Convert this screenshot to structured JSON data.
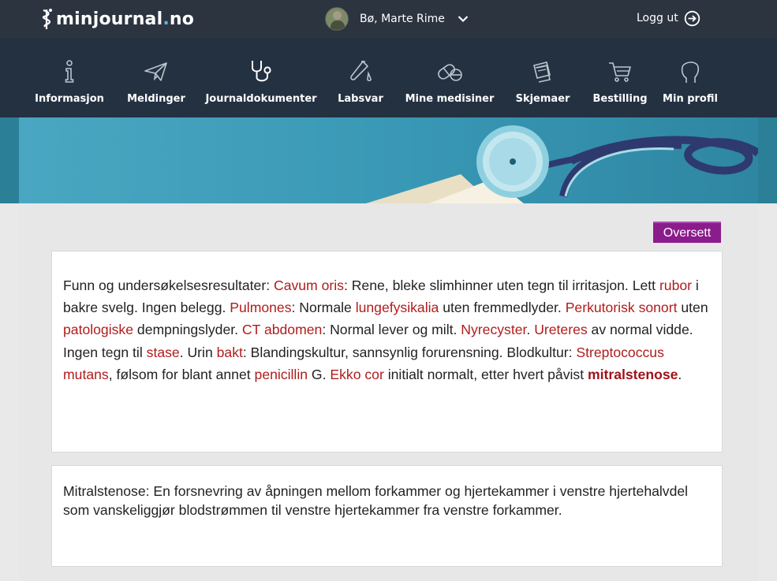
{
  "header": {
    "logo_main": "minjournal",
    "logo_dot": ".",
    "logo_tld": "no",
    "user_name": "Bø, Marte Rime",
    "logout_label": "Logg ut"
  },
  "nav": {
    "items": [
      {
        "label": "Informasjon",
        "icon": "info-icon"
      },
      {
        "label": "Meldinger",
        "icon": "paper-plane-icon"
      },
      {
        "label": "Journaldokumenter",
        "icon": "stethoscope-icon"
      },
      {
        "label": "Labsvar",
        "icon": "test-tube-icon"
      },
      {
        "label": "Mine medisiner",
        "icon": "pill-icon"
      },
      {
        "label": "Skjemaer",
        "icon": "forms-icon"
      },
      {
        "label": "Bestilling",
        "icon": "cart-icon"
      },
      {
        "label": "Min profil",
        "icon": "profile-head-icon"
      }
    ],
    "active_index": 2
  },
  "translate_button": "Oversett",
  "document": {
    "segments": [
      {
        "t": "Funn og undersøkelsesresultater: "
      },
      {
        "t": "Cavum oris",
        "term": true
      },
      {
        "t": ": Rene, bleke slimhinner uten tegn til irritasjon. Lett "
      },
      {
        "t": "rubor",
        "term": true
      },
      {
        "t": " i bakre svelg.  Ingen belegg. "
      },
      {
        "t": "Pulmones",
        "term": true
      },
      {
        "t": ": Normale "
      },
      {
        "t": "lungefysikalia",
        "term": true
      },
      {
        "t": " uten fremmedlyder. "
      },
      {
        "t": "Perkutorisk sonort",
        "term": true
      },
      {
        "t": " uten "
      },
      {
        "t": "patologiske",
        "term": true
      },
      {
        "t": " dempningslyder. "
      },
      {
        "t": "CT abdomen",
        "term": true
      },
      {
        "t": ": Normal lever og milt. "
      },
      {
        "t": "Nyrecyster",
        "term": true
      },
      {
        "t": ". "
      },
      {
        "t": "Ureteres",
        "term": true
      },
      {
        "t": " av normal vidde. Ingen tegn til "
      },
      {
        "t": "stase",
        "term": true
      },
      {
        "t": ". Urin "
      },
      {
        "t": "bakt",
        "term": true
      },
      {
        "t": ": Blandingskultur, sannsynlig forurensning. Blodkultur: "
      },
      {
        "t": "Streptococcus mutans",
        "term": true
      },
      {
        "t": ", følsom for blant annet "
      },
      {
        "t": "penicillin",
        "term": true
      },
      {
        "t": " G. "
      },
      {
        "t": "Ekko cor",
        "term": true
      },
      {
        "t": " initialt normalt, etter hvert påvist "
      },
      {
        "t": "mitralstenose",
        "term": true,
        "strong": true
      },
      {
        "t": "."
      }
    ]
  },
  "definition": {
    "text": "Mitralstenose: En forsnevring av åpningen mellom forkammer og hjertekammer i venstre hjertehalvdel som vanskeliggjør blodstrømmen til venstre hjertekammer fra venstre forkammer."
  },
  "colors": {
    "topbar": "#2c3440",
    "navbar": "#233141",
    "banner": "#2b7f97",
    "term": "#b01c1c",
    "translate_button": "#8a1c8c"
  }
}
